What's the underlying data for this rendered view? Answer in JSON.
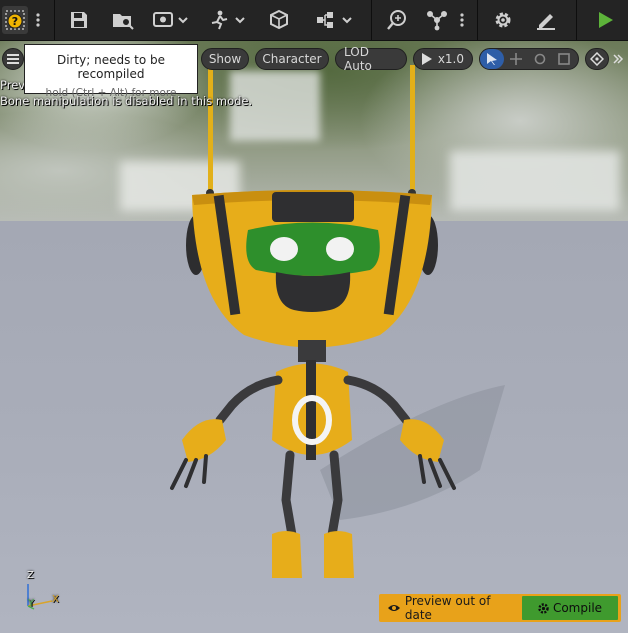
{
  "toolbar": {
    "icons": [
      "blueprint-status-dirty-icon",
      "more-options-icon",
      "save-icon",
      "browse-icon",
      "preview-mesh-icon",
      "animation-icon",
      "make-static-mesh-icon",
      "skeleton-tree-icon",
      "find-icon",
      "hierarchy-icon",
      "more-options-icon",
      "settings-icon",
      "edit-icon",
      "play-icon"
    ]
  },
  "tooltip": {
    "title": "Dirty; needs to be recompiled",
    "hint": "hold (Ctrl + Alt) for more"
  },
  "viewport_toolbar": {
    "show_label": "Show",
    "character_label": "Character",
    "lod_label": "LOD Auto",
    "speed_label": "x1.0"
  },
  "viewport": {
    "preview_label": "Prev",
    "bone_message": "Bone manipulation is disabled in this mode.",
    "axis_z": "Z",
    "axis_y": "Y",
    "axis_x": "X"
  },
  "compile_bar": {
    "status_text": "Preview out of date",
    "compile_label": "Compile",
    "accent_color": "#e8a21a",
    "compile_color": "#3f9a2e"
  }
}
